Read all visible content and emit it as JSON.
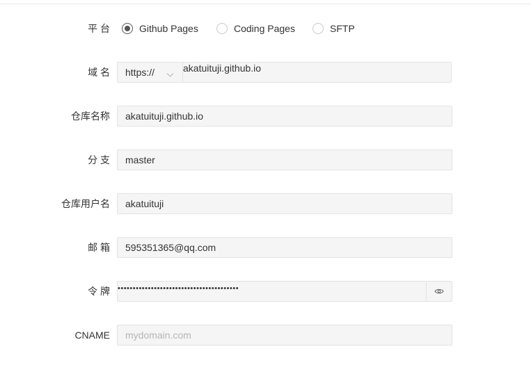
{
  "form": {
    "platform": {
      "label": "平 台",
      "options": [
        {
          "label": "Github Pages",
          "checked": true
        },
        {
          "label": "Coding Pages",
          "checked": false
        },
        {
          "label": "SFTP",
          "checked": false
        }
      ]
    },
    "domain": {
      "label": "域 名",
      "protocol": "https://",
      "value": "akatuituji.github.io"
    },
    "repository": {
      "label": "仓库名称",
      "value": "akatuituji.github.io"
    },
    "branch": {
      "label": "分 支",
      "value": "master"
    },
    "username": {
      "label": "仓库用户名",
      "value": "akatuituji"
    },
    "email": {
      "label": "邮 箱",
      "value": "595351365@qq.com"
    },
    "token": {
      "label": "令 牌",
      "value": "••••••••••••••••••••••••••••••••••••••••"
    },
    "cname": {
      "label": "CNAME",
      "placeholder": "mydomain.com"
    }
  },
  "icons": {
    "protocol_dropdown": "chevron-down-icon",
    "token_toggle": "eye-icon"
  }
}
